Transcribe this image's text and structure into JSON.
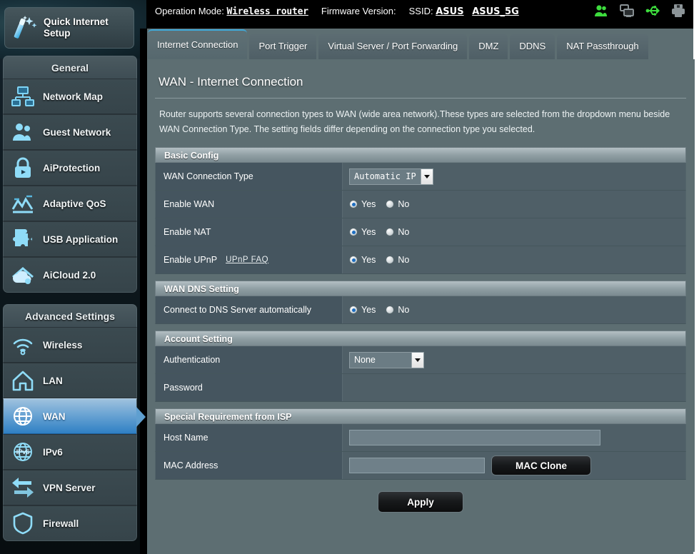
{
  "header": {
    "operation_mode_label": "Operation Mode:",
    "operation_mode_value": "Wireless router",
    "firmware_label": "Firmware Version:",
    "firmware_value": "",
    "ssid_label": "SSID:",
    "ssid_1": "ASUS",
    "ssid_2": "ASUS_5G",
    "icons": [
      {
        "name": "clients-icon",
        "color": "#3ddc3d"
      },
      {
        "name": "screens-icon",
        "color": "#8c9498"
      },
      {
        "name": "usb-icon",
        "color": "#3ddc3d"
      },
      {
        "name": "printer-icon",
        "color": "#8c9498"
      }
    ]
  },
  "quick_setup": {
    "label_line1": "Quick Internet",
    "label_line2": "Setup",
    "icon": "magic-wand-icon"
  },
  "sidebar": {
    "general": {
      "title": "General",
      "items": [
        {
          "label": "Network Map",
          "icon": "network-map-icon"
        },
        {
          "label": "Guest Network",
          "icon": "guest-network-icon"
        },
        {
          "label": "AiProtection",
          "icon": "lock-icon"
        },
        {
          "label": "Adaptive QoS",
          "icon": "chart-icon"
        },
        {
          "label": "USB Application",
          "icon": "puzzle-icon"
        },
        {
          "label": "AiCloud 2.0",
          "icon": "cloud-icon"
        }
      ]
    },
    "advanced": {
      "title": "Advanced Settings",
      "items": [
        {
          "label": "Wireless",
          "icon": "wifi-icon",
          "active": false
        },
        {
          "label": "LAN",
          "icon": "home-icon",
          "active": false
        },
        {
          "label": "WAN",
          "icon": "globe-icon",
          "active": true
        },
        {
          "label": "IPv6",
          "icon": "ipv6-globe-icon",
          "active": false
        },
        {
          "label": "VPN Server",
          "icon": "vpn-arrows-icon",
          "active": false
        },
        {
          "label": "Firewall",
          "icon": "shield-icon",
          "active": false
        }
      ]
    }
  },
  "tabs": [
    {
      "label": "Internet Connection",
      "active": true
    },
    {
      "label": "Port Trigger",
      "active": false
    },
    {
      "label": "Virtual Server / Port Forwarding",
      "active": false
    },
    {
      "label": "DMZ",
      "active": false
    },
    {
      "label": "DDNS",
      "active": false
    },
    {
      "label": "NAT Passthrough",
      "active": false
    }
  ],
  "main": {
    "title": "WAN - Internet Connection",
    "description": "Router supports several connection types to WAN (wide area network).These types are selected from the dropdown menu beside WAN Connection Type. The setting fields differ depending on the connection type you selected.",
    "sections": {
      "basic_config": {
        "title": "Basic Config",
        "wan_connection_type_label": "WAN Connection Type",
        "wan_connection_type_value": "Automatic IP",
        "enable_wan_label": "Enable WAN",
        "enable_wan_value": "Yes",
        "enable_nat_label": "Enable NAT",
        "enable_nat_value": "Yes",
        "enable_upnp_label": "Enable UPnP",
        "enable_upnp_link": "UPnP FAQ",
        "enable_upnp_value": "Yes"
      },
      "wan_dns": {
        "title": "WAN DNS Setting",
        "connect_dns_label": "Connect to DNS Server automatically",
        "connect_dns_value": "Yes"
      },
      "account": {
        "title": "Account Setting",
        "authentication_label": "Authentication",
        "authentication_value": "None",
        "password_label": "Password",
        "password_value": ""
      },
      "isp": {
        "title": "Special Requirement from ISP",
        "host_name_label": "Host Name",
        "host_name_value": "",
        "mac_address_label": "MAC Address",
        "mac_address_value": "",
        "mac_clone_label": "MAC Clone"
      }
    },
    "radio_yes": "Yes",
    "radio_no": "No",
    "apply_label": "Apply"
  }
}
